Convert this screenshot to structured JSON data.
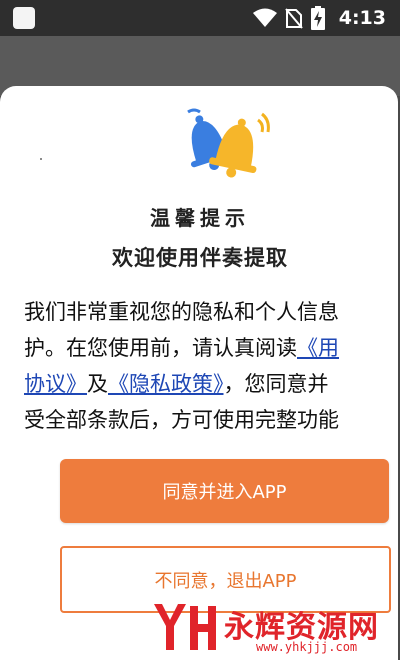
{
  "status_bar": {
    "time": "4:13",
    "icons": [
      "wifi-icon",
      "no-sim-icon",
      "battery-charging-icon"
    ]
  },
  "dialog": {
    "title": "温馨提示",
    "subtitle": "欢迎使用伴奏提取",
    "body": {
      "line1": "我们非常重视您的隐私和个人信息",
      "line2_pre": "护。在您使用前，请认真阅读",
      "line2_link": "《用",
      "line3_link1": "协议》",
      "line3_mid": "及",
      "line3_link2": "《隐私政策》",
      "line3_post": "，您同意并",
      "line4": "受全部条款后，方可使用完整功能"
    },
    "agree_button": "同意并进入APP",
    "disagree_button": "不同意，退出APP",
    "accent_color": "#ee7c3d",
    "link_color": "#1e47b5"
  },
  "watermark": {
    "text": "永辉资源网",
    "url": "www.yhkjjj.com"
  }
}
